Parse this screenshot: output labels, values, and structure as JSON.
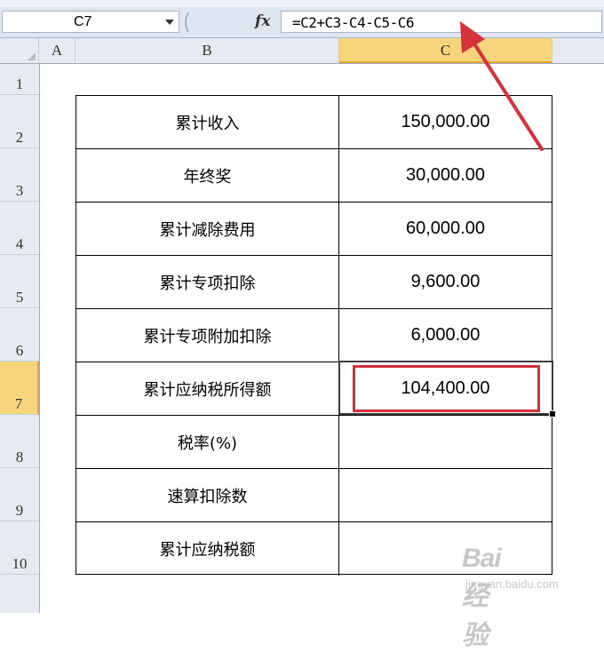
{
  "formula_bar": {
    "name_box": "C7",
    "fx_label": "fx",
    "formula": "=C2+C3-C4-C5-C6"
  },
  "columns": [
    "A",
    "B",
    "C"
  ],
  "row_numbers": [
    "1",
    "2",
    "3",
    "4",
    "5",
    "6",
    "7",
    "8",
    "9",
    "10"
  ],
  "active_cell": "C7",
  "table": {
    "rows": [
      {
        "label": "累计收入",
        "value": "150,000.00"
      },
      {
        "label": "年终奖",
        "value": "30,000.00"
      },
      {
        "label": "累计减除费用",
        "value": "60,000.00"
      },
      {
        "label": "累计专项扣除",
        "value": "9,600.00"
      },
      {
        "label": "累计专项附加扣除",
        "value": "6,000.00"
      },
      {
        "label": "累计应纳税所得额",
        "value": "104,400.00"
      },
      {
        "label": "税率(%)",
        "value": ""
      },
      {
        "label": "速算扣除数",
        "value": ""
      },
      {
        "label": "累计应纳税额",
        "value": ""
      }
    ]
  },
  "annotation_color": "#d5313b",
  "highlight_color": "#f7d57c",
  "watermark": {
    "logo": "Bai经验",
    "url": "jingyan.baidu.com"
  }
}
